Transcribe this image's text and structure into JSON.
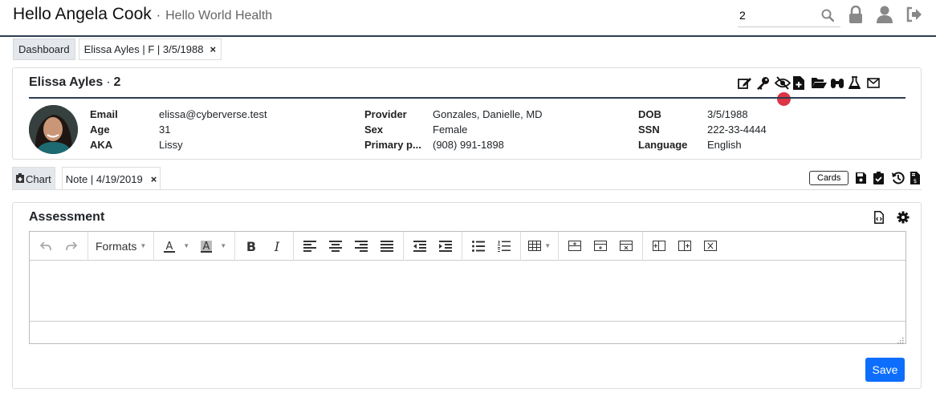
{
  "header": {
    "greeting": "Hello Angela Cook",
    "separator": "·",
    "org": "Hello World Health",
    "search_value": "2",
    "icons": [
      "search-icon",
      "lock-icon",
      "user-icon",
      "sign-out-icon"
    ]
  },
  "tabs": [
    {
      "label": "Dashboard",
      "active": false
    },
    {
      "label": "Elissa Ayles | F | 3/5/1988",
      "closable": true,
      "active": true
    }
  ],
  "patient": {
    "name": "Elissa Ayles",
    "separator": "·",
    "id": "2",
    "actions": [
      "edit-icon",
      "key-icon",
      "eye-slash-icon",
      "file-medical-icon",
      "folder-open-icon",
      "binoculars-icon",
      "flask-icon",
      "envelope-icon"
    ],
    "fields": {
      "email_label": "Email",
      "email": "elissa@cyberverse.test",
      "age_label": "Age",
      "age": "31",
      "aka_label": "AKA",
      "aka": "Lissy",
      "provider_label": "Provider",
      "provider": "Gonzales, Danielle, MD",
      "sex_label": "Sex",
      "sex": "Female",
      "primary_label": "Primary p...",
      "primary": "(908) 991-1898",
      "dob_label": "DOB",
      "dob": "3/5/1988",
      "ssn_label": "SSN",
      "ssn": "222-33-4444",
      "language_label": "Language",
      "language": "English"
    }
  },
  "note_tabs": [
    {
      "label": "Chart",
      "active": false
    },
    {
      "label": "Note | 4/19/2019",
      "closable": true,
      "active": true
    }
  ],
  "note_actions": {
    "cards_label": "Cards",
    "icons": [
      "save-icon",
      "clipboard-check-icon",
      "history-icon",
      "file-invoice-icon"
    ]
  },
  "assessment": {
    "title": "Assessment",
    "icons": [
      "file-code-icon",
      "cog-icon"
    ],
    "toolbar": {
      "formats_label": "Formats"
    },
    "save_label": "Save"
  },
  "colors": {
    "primary": "#0d6efd",
    "rule": "#2c3e50",
    "notification": "#dc3545",
    "tab_gray": "#e4e8ec"
  }
}
